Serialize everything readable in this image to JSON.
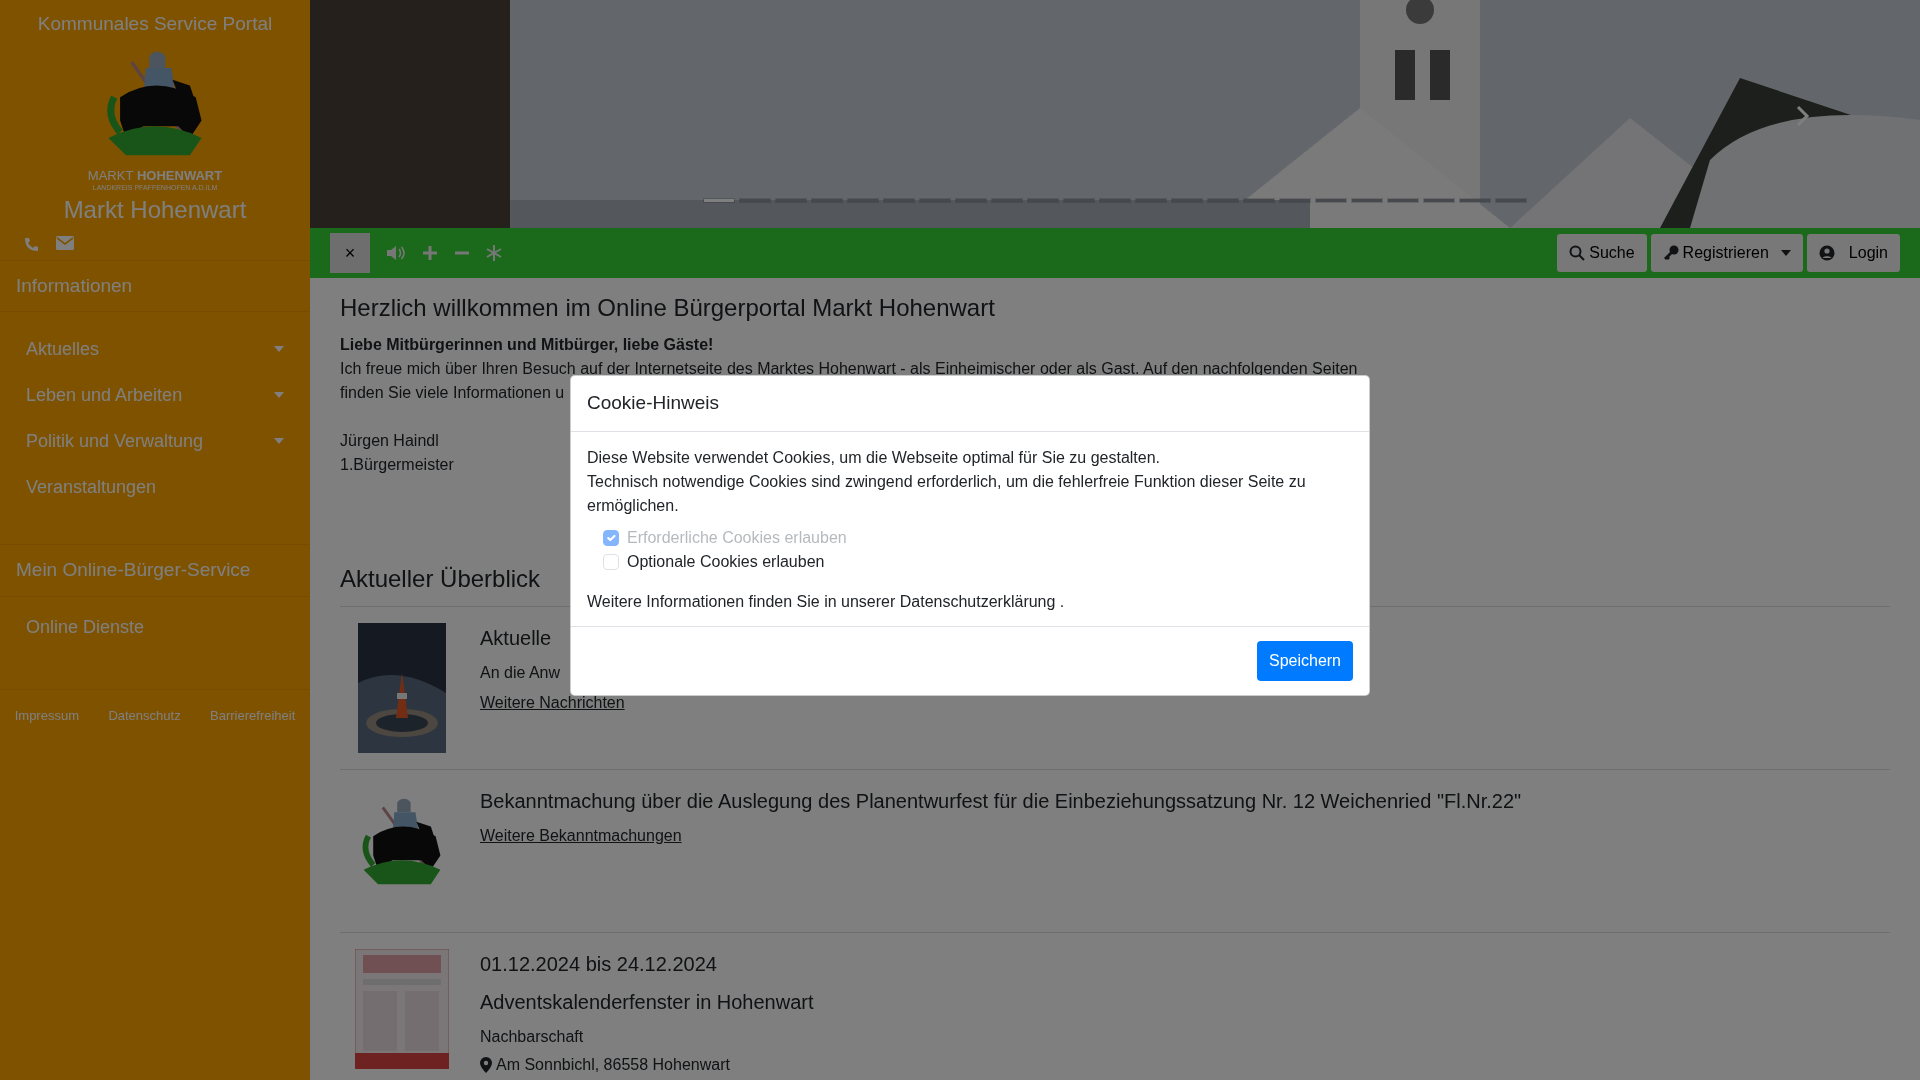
{
  "sidebar": {
    "portal_title": "Kommunales Service Portal",
    "logo": {
      "line1": "MARKT",
      "line2": "HOHENWART",
      "line3": "LANDKREIS PFAFFENHOFEN A.D.ILM"
    },
    "town": "Markt Hohenwart",
    "sections": [
      {
        "title": "Informationen",
        "items": [
          {
            "label": "Aktuelles",
            "expandable": true
          },
          {
            "label": "Leben und Arbeiten",
            "expandable": true
          },
          {
            "label": "Politik und Verwaltung",
            "expandable": true
          },
          {
            "label": "Veranstaltungen",
            "expandable": false
          }
        ]
      },
      {
        "title": "Mein Online-Bürger-Service",
        "items": [
          {
            "label": "Online Dienste",
            "expandable": false
          }
        ]
      }
    ],
    "footer_links": [
      "Impressum",
      "Datenschutz",
      "Barrierefreiheit"
    ]
  },
  "hero": {
    "indicators": [
      {
        "selected": true
      },
      {
        "selected": false
      },
      {
        "selected": false
      },
      {
        "selected": false
      },
      {
        "selected": false
      },
      {
        "selected": false
      },
      {
        "selected": false
      },
      {
        "selected": false
      },
      {
        "selected": false
      },
      {
        "selected": false
      },
      {
        "selected": false
      },
      {
        "selected": false
      },
      {
        "selected": false
      },
      {
        "selected": false
      },
      {
        "selected": false
      },
      {
        "selected": false
      },
      {
        "selected": false
      },
      {
        "selected": false
      },
      {
        "selected": false
      },
      {
        "selected": false
      },
      {
        "selected": false
      },
      {
        "selected": false
      },
      {
        "selected": false
      }
    ]
  },
  "toolbar": {
    "close": "×",
    "buttons": [
      {
        "label": "Suche",
        "dropdown": false
      },
      {
        "label": "Registrieren",
        "dropdown": true
      },
      {
        "label": "Login",
        "dropdown": false
      }
    ]
  },
  "main": {
    "heading": "Herzlich willkommen im Online Bürgerportal Markt Hohenwart",
    "greeting": "Liebe Mitbürgerinnen und Mitbürger, liebe Gäste!",
    "paragraph_lines": [
      "Ich freue mich über Ihren Besuch auf der Internetseite des Marktes Hohenwart - als Einheimischer oder als Gast. Auf den nachfolgenden Seiten",
      "finden Sie viele Informationen u"
    ],
    "signature": [
      "Jürgen Haindl",
      "1.Bürgermeister"
    ],
    "section_title": "Aktueller Überblick",
    "items": [
      {
        "kind": "news",
        "title": "Aktuelle ",
        "text": "An die Anw",
        "link": "Weitere Nachrichten"
      },
      {
        "kind": "notice",
        "title": "Bekanntmachung über die Auslegung des Planentwurfest für die Einbeziehungssatzung Nr. 12 Weichenried \"Fl.Nr.22\"",
        "link": "Weitere Bekanntmachungen"
      },
      {
        "kind": "event",
        "date": "01.12.2024 bis 24.12.2024",
        "title": "Adventskalenderfenster in Hohenwart",
        "organizer": "Nachbarschaft",
        "location": "Am Sonnbichl, 86558 Hohenwart"
      }
    ]
  },
  "modal": {
    "title": "Cookie-Hinweis",
    "text_lines": [
      "Diese Website verwendet Cookies, um die Webseite optimal für Sie zu gestalten.",
      "Technisch notwendige Cookies sind zwingend erforderlich, um die fehlerfreie Funktion dieser Seite zu ermöglichen."
    ],
    "options": [
      {
        "label": "Erforderliche Cookies erlauben",
        "checked": true,
        "disabled": true
      },
      {
        "label": "Optionale Cookies erlauben",
        "checked": false,
        "disabled": false
      }
    ],
    "info": "Weitere Informationen finden Sie in unserer Datenschutzerklärung .",
    "save": "Speichern"
  }
}
